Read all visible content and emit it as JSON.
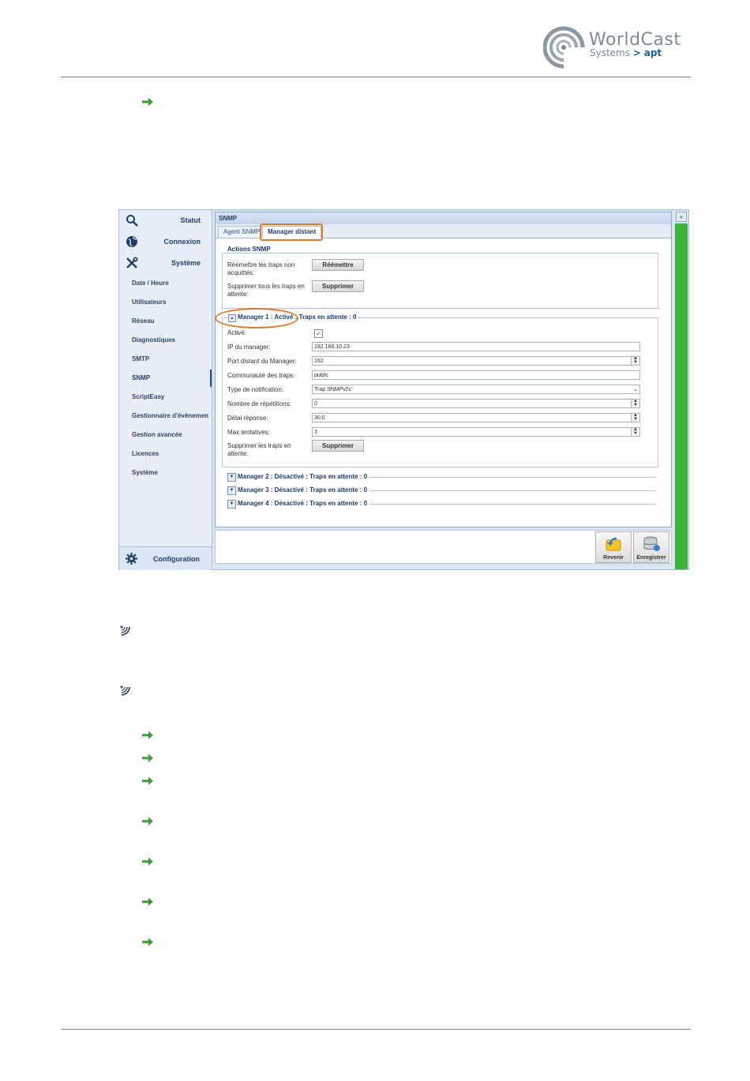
{
  "logo": {
    "name": "WorldCast",
    "sub": "Systems",
    "sep": ">",
    "brand": "apt"
  },
  "colors": {
    "accent": "#1c3d6b",
    "highlight": "#e87722",
    "status_green": "#3ab53a",
    "rule": "#5e86b8"
  },
  "sidebar": {
    "main": [
      {
        "label": "Statut",
        "icon": "search-icon"
      },
      {
        "label": "Connexion",
        "icon": "globe-icon"
      },
      {
        "label": "Système",
        "icon": "tools-icon"
      }
    ],
    "sub": [
      "Date / Heure",
      "Utilisateurs",
      "Réseau",
      "Diagnostiques",
      "SMTP",
      "SNMP",
      "ScriptEasy",
      "Gestionnaire d'évènemen",
      "Gestion avancée",
      "Licences",
      "Système"
    ],
    "selected": "SNMP",
    "bottom": {
      "label": "Configuration",
      "icon": "gear-icon"
    }
  },
  "panel": {
    "title": "SNMP",
    "tabs": [
      "Agent SNMP",
      "Manager distant"
    ],
    "active_tab": "Manager distant",
    "actions": {
      "legend": "Actions SNMP",
      "row1_label": "Réémettre les traps non acquittés:",
      "row1_button": "Réémettre",
      "row2_label": "Supprimer tous les traps en attente:",
      "row2_button": "Supprimer"
    },
    "manager1": {
      "legend": "Manager 1 : Activé : Traps en attente : 0",
      "fields": {
        "active_label": "Activé:",
        "active_checked": true,
        "ip_label": "IP du manager:",
        "ip_value": "192.168.10.23",
        "port_label": "Port distant du Manager:",
        "port_value": "162",
        "community_label": "Communauté des traps:",
        "community_value": "public",
        "notif_label": "Type de notification:",
        "notif_value": "Trap SNMPv2c",
        "repeat_label": "Nombre de répétitions:",
        "repeat_value": "0",
        "delay_label": "Délai réponse:",
        "delay_value": "30.0",
        "max_label": "Max tentatives:",
        "max_value": "3",
        "delete_label": "Supprimer les traps en attente:",
        "delete_button": "Supprimer"
      }
    },
    "managers_collapsed": [
      "Manager 2 : Désactivé : Traps en attente : 0",
      "Manager 3 : Désactivé : Traps en attente : 0",
      "Manager 4 : Désactivé : Traps en attente : 0"
    ],
    "footer_buttons": [
      {
        "label": "Revenir",
        "icon": "revert-icon"
      },
      {
        "label": "Enregistrer",
        "icon": "save-database-icon"
      }
    ]
  },
  "glyphs": {
    "check": "✓",
    "expanded": "▲",
    "collapsed": "▼",
    "spin_up": "▲",
    "spin_down": "▼",
    "dropdown": "⌄",
    "collapse_panel": "«"
  }
}
